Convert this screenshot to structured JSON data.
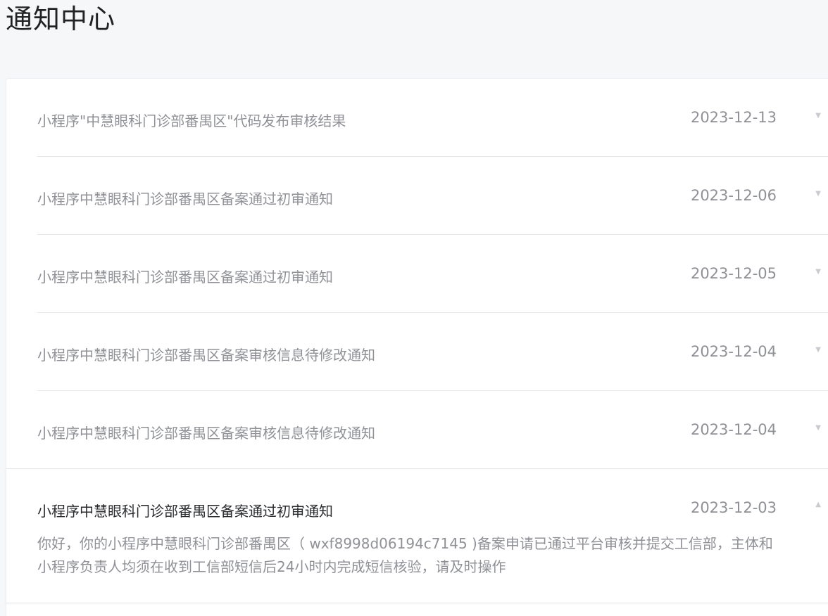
{
  "page": {
    "title": "通知中心"
  },
  "notices": [
    {
      "title": "小程序\"中慧眼科门诊部番禺区\"代码发布审核结果",
      "date": "2023-12-13",
      "arrow": "▼"
    },
    {
      "title": "小程序中慧眼科门诊部番禺区备案通过初审通知",
      "date": "2023-12-06",
      "arrow": "▼"
    },
    {
      "title": "小程序中慧眼科门诊部番禺区备案通过初审通知",
      "date": "2023-12-05",
      "arrow": "▼"
    },
    {
      "title": "小程序中慧眼科门诊部番禺区备案审核信息待修改通知",
      "date": "2023-12-04",
      "arrow": "▼"
    },
    {
      "title": "小程序中慧眼科门诊部番禺区备案审核信息待修改通知",
      "date": "2023-12-04",
      "arrow": "▼"
    },
    {
      "title": "小程序中慧眼科门诊部番禺区备案通过初审通知",
      "date": "2023-12-03",
      "arrow": "▲",
      "content": "你好，你的小程序中慧眼科门诊部番禺区（ wxf8998d06194c7145 )备案申请已通过平台审核并提交工信部，主体和小程序负责人均须在收到工信部短信后24小时内完成短信核验，请及时操作"
    }
  ],
  "colors": {
    "page_background": "#f6f7f9",
    "card_background": "#ffffff",
    "muted_text": "#8f9196",
    "active_text": "#2a2b2e"
  }
}
